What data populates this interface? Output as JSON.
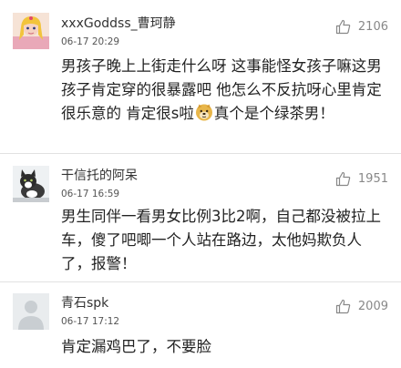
{
  "comments": [
    {
      "username": "xxxGoddss_曹珂静",
      "time": "06-17 20:29",
      "likes": "2106",
      "text_before_emoji": "男孩子晚上上街走什么呀 这事能怪女孩子嘛这男孩子肯定穿的很暴露吧 他怎么不反抗呀心里肯定很乐意的 肯定很s啦",
      "text_after_emoji": "真个是个绿茶男！",
      "emoji": "doge-emoji"
    },
    {
      "username": "干信托的阿呆",
      "time": "06-17 16:59",
      "likes": "1951",
      "text": "男生同伴一看男女比例3比2啊，自己都没被拉上车，傻了吧唧一个人站在路边，太他妈欺负人了，报警！"
    },
    {
      "username": "青石spk",
      "time": "06-17 17:12",
      "likes": "2009",
      "text": "肯定漏鸡巴了，不要脸"
    }
  ],
  "icons": {
    "like": "thumbs-up-icon"
  },
  "colors": {
    "background": "#ffffff",
    "text": "#222222",
    "meta": "#555555",
    "like": "#888888",
    "divider": "#e2e2e2"
  }
}
